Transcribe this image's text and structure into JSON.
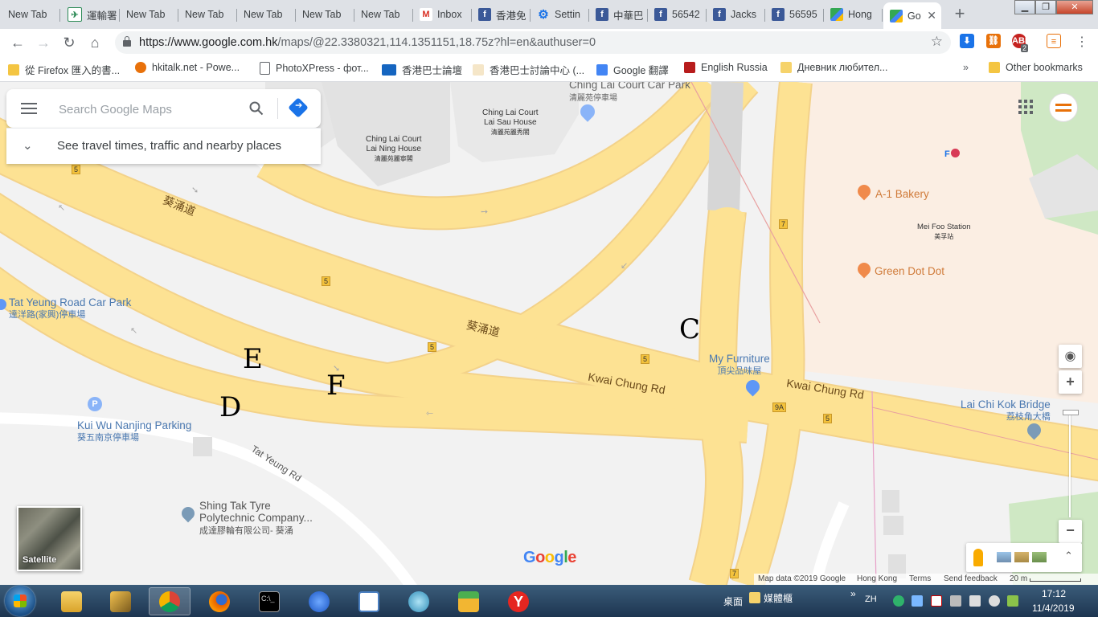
{
  "tabs": [
    {
      "label": "New Tab",
      "icon": "none"
    },
    {
      "label": "運輸署",
      "icon": "bus-logo-icon"
    },
    {
      "label": "New Tab",
      "icon": "none"
    },
    {
      "label": "New Tab",
      "icon": "none"
    },
    {
      "label": "New Tab",
      "icon": "none"
    },
    {
      "label": "New Tab",
      "icon": "none"
    },
    {
      "label": "New Tab",
      "icon": "none"
    },
    {
      "label": "Inbox",
      "icon": "gmail-icon"
    },
    {
      "label": "香港免",
      "icon": "facebook-icon"
    },
    {
      "label": "Settin",
      "icon": "gear-icon"
    },
    {
      "label": "中華巴",
      "icon": "facebook-icon"
    },
    {
      "label": "56542",
      "icon": "facebook-icon"
    },
    {
      "label": "Jacks",
      "icon": "facebook-icon"
    },
    {
      "label": "56595",
      "icon": "facebook-icon"
    },
    {
      "label": "Hong",
      "icon": "google-maps-icon"
    },
    {
      "label": "Go",
      "icon": "google-maps-icon"
    }
  ],
  "toolbar": {
    "url_host": "https://www.google.com.hk",
    "url_rest": "/maps/@22.3380321,114.1351151,18.75z?hl=en&authuser=0",
    "abp_badge": "2"
  },
  "bookmarks": [
    {
      "label": "從 Firefox 匯入的書...",
      "icon": "folder-icon"
    },
    {
      "label": "hkitalk.net - Powe...",
      "icon": "hkitalk-icon"
    },
    {
      "label": "PhotoXPress - фот...",
      "icon": "page-icon"
    },
    {
      "label": "香港巴士論壇",
      "icon": "hkbf-icon"
    },
    {
      "label": "香港巴士討論中心 (...",
      "icon": "hkbdc-icon"
    },
    {
      "label": "Google 翻譯",
      "icon": "translate-icon"
    },
    {
      "label": "English Russia",
      "icon": "english-russia-icon"
    },
    {
      "label": "Дневник любител...",
      "icon": "diary-icon"
    },
    {
      "label": "Other bookmarks",
      "icon": "folder-icon"
    }
  ],
  "map": {
    "search_placeholder": "Search Google Maps",
    "travel_text": "See travel times, traffic and nearby places",
    "labels": {
      "kwai_chung_rd_zh_left": "葵涌道",
      "kwai_chung_rd_zh_mid": "葵涌道",
      "kwai_chung_rd_en_mid": "Kwai Chung Rd",
      "kwai_chung_rd_en_right": "Kwai Chung Rd",
      "tat_yeung_rd": "Tat Yeung Rd",
      "ching_lai_carpark_en": "Ching Lai Court Car Park",
      "ching_lai_carpark_zh": "清麗苑停車場",
      "lai_sau_en1": "Ching Lai Court",
      "lai_sau_en2": "Lai Sau House",
      "lai_sau_zh": "清麗苑麗秀閣",
      "lai_ning_en1": "Ching Lai Court",
      "lai_ning_en2": "Lai Ning House",
      "lai_ning_zh": "清麗苑麗寧閣",
      "tat_yeung_carpark_en": "Tat Yeung Road Car Park",
      "tat_yeung_carpark_zh": "達洋路(家興)停車場",
      "kui_wu_en": "Kui Wu Nanjing Parking",
      "kui_wu_zh": "葵五南京停車場",
      "shing_tak_en1": "Shing Tak Tyre",
      "shing_tak_en2": "Polytechnic Company...",
      "shing_tak_zh": "成達膠輪有限公司- 葵涌",
      "a1_bakery": "A-1 Bakery",
      "green_dot_dot": "Green Dot Dot",
      "mei_foo_en": "Mei Foo Station",
      "mei_foo_zh": "美孚站",
      "my_furniture_en": "My Furniture",
      "my_furniture_zh": "頂尖品味屋",
      "lai_chi_kok_en": "Lai Chi Kok Bridge",
      "lai_chi_kok_zh": "荔枝角大橋"
    },
    "route_shields": [
      "5",
      "5",
      "5",
      "5",
      "5",
      "7",
      "7",
      "9A"
    ],
    "annotation_letters": [
      "C",
      "E",
      "F",
      "D"
    ],
    "satellite_label": "Satellite",
    "footer": {
      "map_data": "Map data ©2019 Google",
      "region": "Hong Kong",
      "terms": "Terms",
      "feedback": "Send feedback",
      "scale": "20 m"
    }
  },
  "taskbar": {
    "desktop": "桌面",
    "media_folder": "媒體櫃",
    "lang": "ZH",
    "time": "17:12",
    "date": "11/4/2019"
  }
}
